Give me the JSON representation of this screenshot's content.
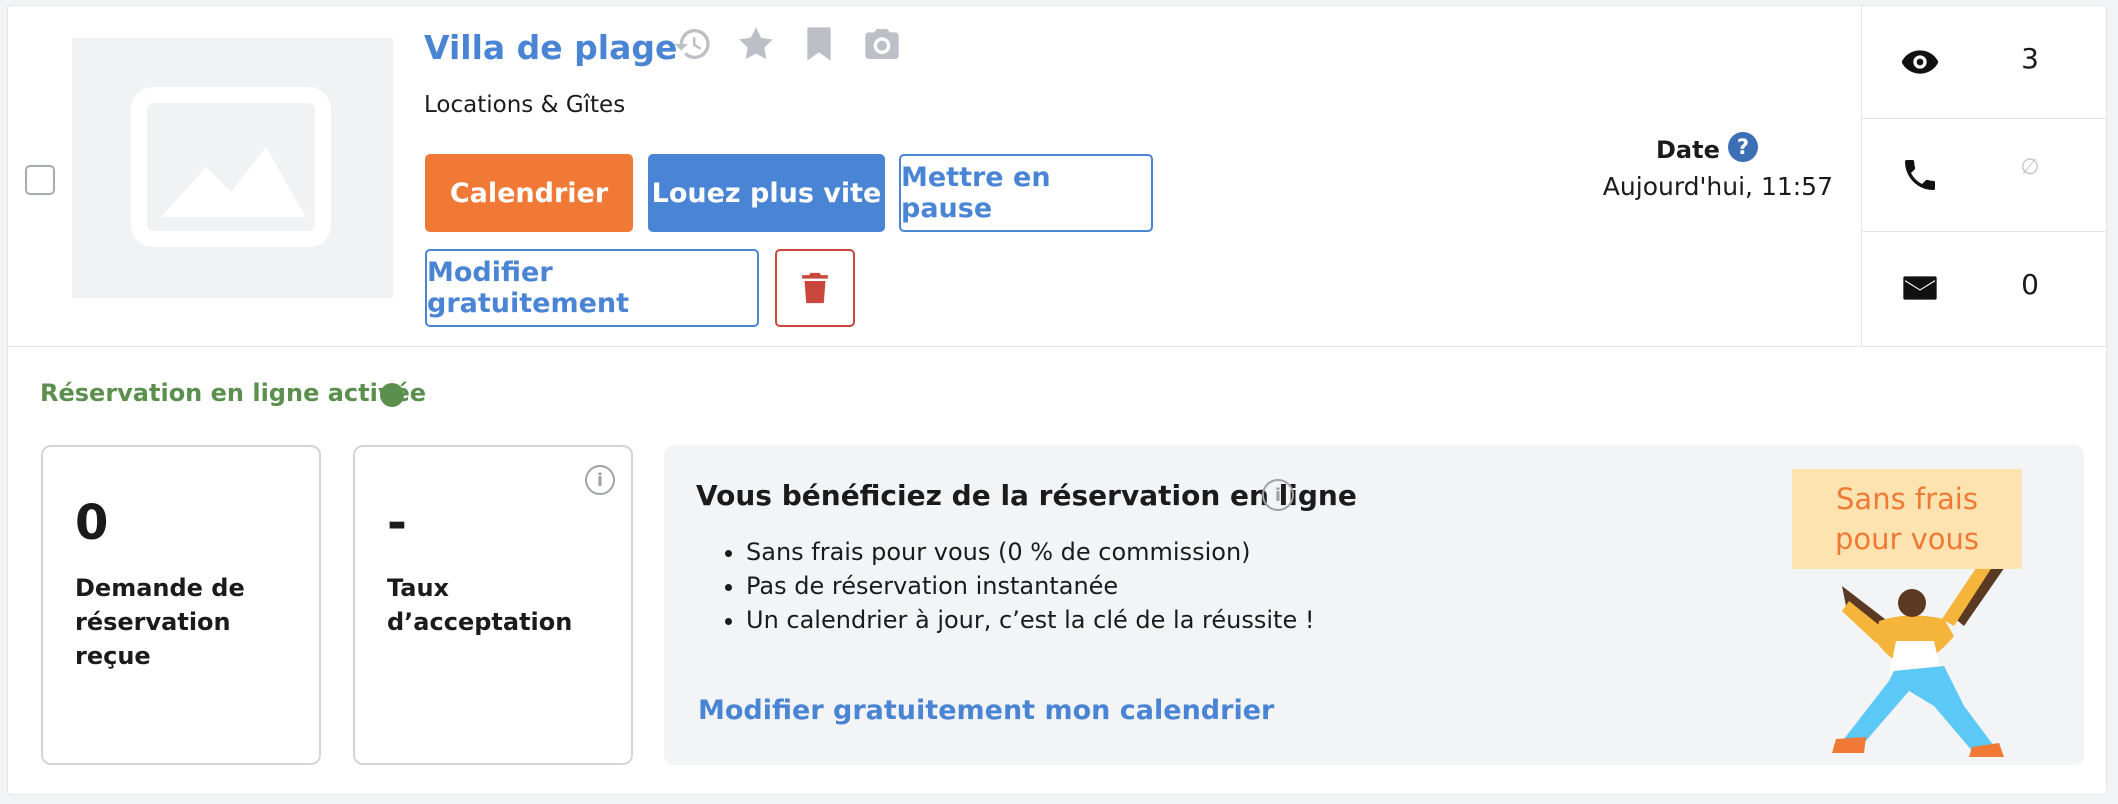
{
  "listing": {
    "title": "Villa de plage",
    "category": "Locations & Gîtes",
    "title_icons": [
      "history-icon",
      "star-icon",
      "bookmark-icon",
      "camera-icon"
    ]
  },
  "actions": {
    "calendar_label": "Calendrier",
    "boost_label": "Louez plus vite",
    "pause_label": "Mettre en pause",
    "edit_label": "Modifier gratuitement",
    "delete_icon": "trash-icon"
  },
  "date": {
    "label": "Date",
    "help": "?",
    "value": "Aujourd'hui, 11:57"
  },
  "stats": {
    "views": "3",
    "calls": "∅",
    "messages": "0"
  },
  "online_booking": {
    "status": "Réservation en ligne activée",
    "status_color": "#5a8f4e"
  },
  "kpis": [
    {
      "value": "0",
      "label": "Demande de réservation reçue"
    },
    {
      "value": "-",
      "label": "Taux d’acceptation",
      "info": "i"
    }
  ],
  "promo": {
    "title": "Vous bénéficiez de la réservation en ligne",
    "info": "i",
    "bullets": [
      "Sans frais pour vous (0 % de commission)",
      "Pas de réservation instantanée",
      "Un calendrier à jour, c’est la clé de la réussite !"
    ],
    "link": "Modifier gratuitement mon calendrier",
    "badge_line1": "Sans frais",
    "badge_line2": "pour vous"
  },
  "colors": {
    "accent_blue": "#4a84d4",
    "accent_orange": "#f07a35",
    "danger_red": "#c9473d"
  }
}
